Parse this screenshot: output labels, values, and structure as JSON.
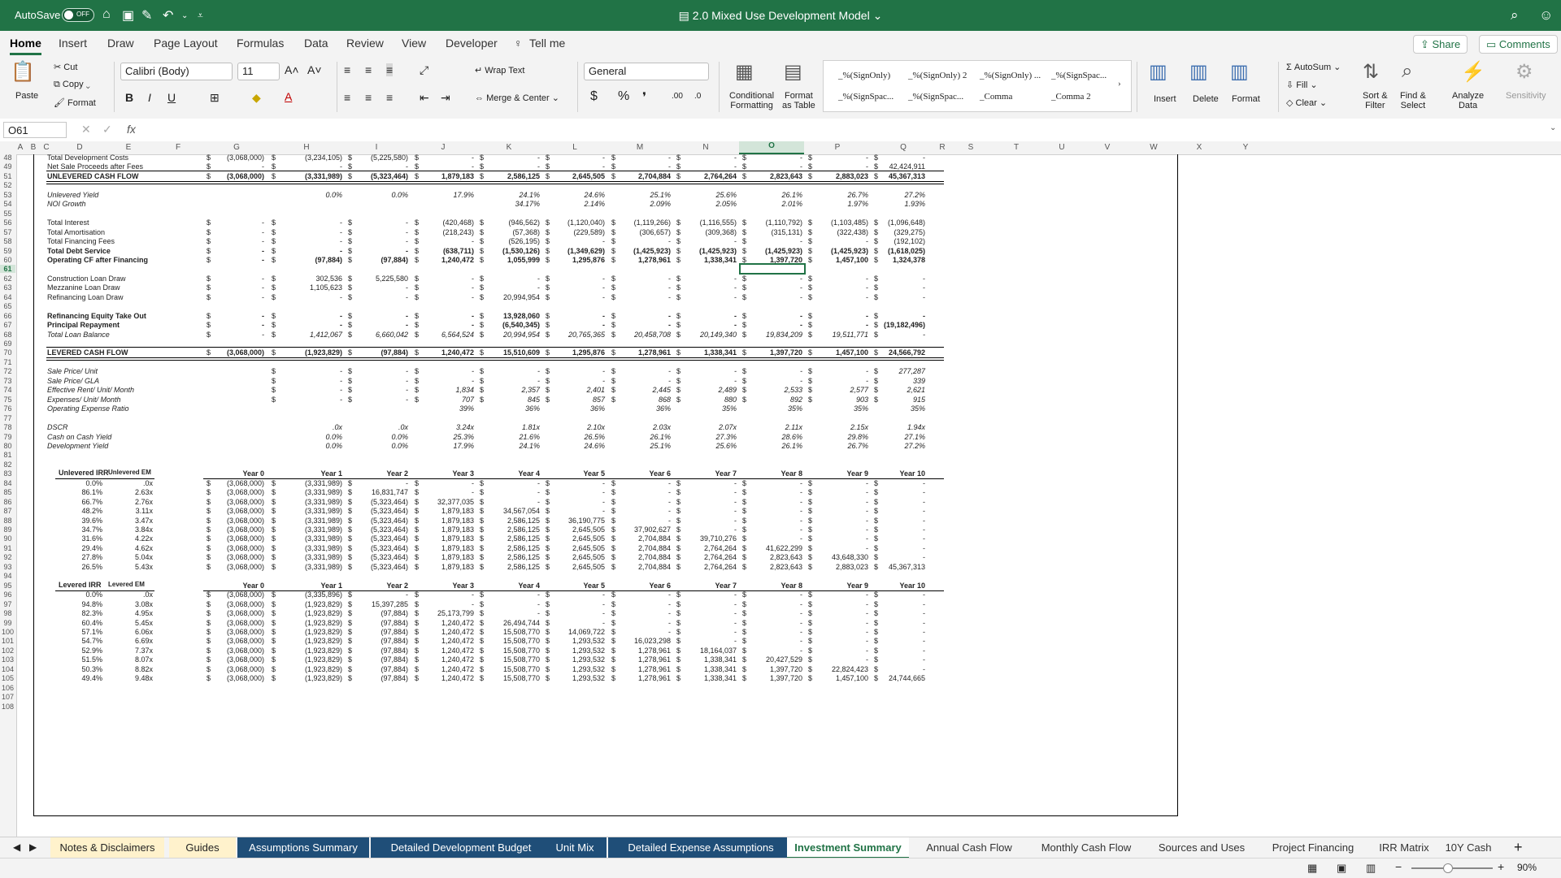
{
  "titlebar": {
    "autosave_label": "AutoSave",
    "autosave_state": "OFF",
    "doc_title": "2.0 Mixed Use Development Model"
  },
  "ribbon_tabs": [
    "Home",
    "Insert",
    "Draw",
    "Page Layout",
    "Formulas",
    "Data",
    "Review",
    "View",
    "Developer",
    "Tell me"
  ],
  "share_label": "Share",
  "comments_label": "Comments",
  "ribbon": {
    "paste": "Paste",
    "cut": "Cut",
    "copy": "Copy",
    "format": "Format",
    "font_name": "Calibri (Body)",
    "font_size": "11",
    "wrap_text": "Wrap Text",
    "merge_center": "Merge & Center",
    "number_format": "General",
    "cond_format": "Conditional",
    "cond_format2": "Formatting",
    "format_table": "Format",
    "format_table2": "as Table",
    "styles": [
      "_%(SignOnly)",
      "_%(SignOnly) 2",
      "_%(SignOnly) ...",
      "_%(SignSpac...",
      "_%(SignSpac...",
      "_%(SignSpac...",
      "_Comma",
      "_Comma 2"
    ],
    "insert": "Insert",
    "delete": "Delete",
    "format_cells": "Format",
    "autosum": "AutoSum",
    "fill": "Fill",
    "clear": "Clear",
    "sort_filter": "Sort &",
    "sort_filter2": "Filter",
    "find_select": "Find &",
    "find_select2": "Select",
    "analyze": "Analyze",
    "analyze2": "Data",
    "sensitivity": "Sensitivity"
  },
  "formula_bar": {
    "name_box": "O61",
    "fx": "fx"
  },
  "columns": [
    "A",
    "B",
    "C",
    "D",
    "E",
    "F",
    "G",
    "H",
    "I",
    "J",
    "K",
    "L",
    "M",
    "N",
    "O",
    "P",
    "Q",
    "R",
    "S",
    "T",
    "U",
    "V",
    "W",
    "X",
    "Y"
  ],
  "row_numbers": [
    "48",
    "49",
    "51",
    "52",
    "53",
    "54",
    "55",
    "56",
    "57",
    "58",
    "59",
    "60",
    "61",
    "62",
    "63",
    "64",
    "65",
    "66",
    "67",
    "68",
    "69",
    "70",
    "71",
    "72",
    "73",
    "74",
    "75",
    "76",
    "77",
    "78",
    "79",
    "80",
    "81",
    "82",
    "83",
    "84",
    "85",
    "86",
    "87",
    "88",
    "89",
    "90",
    "91",
    "92",
    "93",
    "94",
    "95",
    "96",
    "97",
    "98",
    "99",
    "100",
    "101",
    "102",
    "103",
    "104",
    "105",
    "106",
    "107",
    "108"
  ],
  "rows": {
    "r48": {
      "label": "Total Development Costs",
      "vals": [
        "(3,068,000)",
        "(3,234,105)",
        "(5,225,580)",
        "-",
        "-",
        "-",
        "-",
        "-",
        "-",
        "-",
        "-"
      ]
    },
    "r49": {
      "label": "Net Sale Proceeds after Fees",
      "vals": [
        "-",
        "-",
        "-",
        "-",
        "-",
        "-",
        "-",
        "-",
        "-",
        "-",
        "42,424,911"
      ]
    },
    "r51": {
      "label": "UNLEVERED CASH FLOW",
      "vals": [
        "(3,068,000)",
        "(3,331,989)",
        "(5,323,464)",
        "1,879,183",
        "2,586,125",
        "2,645,505",
        "2,704,884",
        "2,764,264",
        "2,823,643",
        "2,883,023",
        "45,367,313"
      ]
    },
    "r53": {
      "label": "Unlevered Yield",
      "vals": [
        "",
        "0.0%",
        "0.0%",
        "17.9%",
        "24.1%",
        "24.6%",
        "25.1%",
        "25.6%",
        "26.1%",
        "26.7%",
        "27.2%"
      ]
    },
    "r54": {
      "label": "NOI Growth",
      "vals": [
        "",
        "",
        "",
        "",
        "34.17%",
        "2.14%",
        "2.09%",
        "2.05%",
        "2.01%",
        "1.97%",
        "1.93%"
      ]
    },
    "r56": {
      "label": "Total Interest",
      "vals": [
        "-",
        "-",
        "-",
        "(420,468)",
        "(946,562)",
        "(1,120,040)",
        "(1,119,266)",
        "(1,116,555)",
        "(1,110,792)",
        "(1,103,485)",
        "(1,096,648)"
      ]
    },
    "r57": {
      "label": "Total Amortisation",
      "vals": [
        "-",
        "-",
        "-",
        "(218,243)",
        "(57,368)",
        "(229,589)",
        "(306,657)",
        "(309,368)",
        "(315,131)",
        "(322,438)",
        "(329,275)"
      ]
    },
    "r58": {
      "label": "Total Financing Fees",
      "vals": [
        "-",
        "-",
        "-",
        "-",
        "(526,195)",
        "-",
        "-",
        "-",
        "-",
        "-",
        "(192,102)"
      ]
    },
    "r59": {
      "label": "Total Debt Service",
      "vals": [
        "-",
        "-",
        "-",
        "(638,711)",
        "(1,530,126)",
        "(1,349,629)",
        "(1,425,923)",
        "(1,425,923)",
        "(1,425,923)",
        "(1,425,923)",
        "(1,618,025)"
      ]
    },
    "r60": {
      "label": "Operating CF after Financing",
      "vals": [
        "-",
        "(97,884)",
        "(97,884)",
        "1,240,472",
        "1,055,999",
        "1,295,876",
        "1,278,961",
        "1,338,341",
        "1,397,720",
        "1,457,100",
        "1,324,378"
      ]
    },
    "r62": {
      "label": "Construction Loan Draw",
      "vals": [
        "-",
        "302,536",
        "5,225,580",
        "-",
        "-",
        "-",
        "-",
        "-",
        "-",
        "-",
        "-"
      ]
    },
    "r63": {
      "label": "Mezzanine Loan Draw",
      "vals": [
        "-",
        "1,105,623",
        "-",
        "-",
        "-",
        "-",
        "-",
        "-",
        "-",
        "-",
        "-"
      ]
    },
    "r64": {
      "label": "Refinancing Loan Draw",
      "vals": [
        "-",
        "-",
        "-",
        "-",
        "20,994,954",
        "-",
        "-",
        "-",
        "-",
        "-",
        "-"
      ]
    },
    "r66": {
      "label": "Refinancing Equity Take Out",
      "vals": [
        "-",
        "-",
        "-",
        "-",
        "13,928,060",
        "-",
        "-",
        "-",
        "-",
        "-",
        "-"
      ]
    },
    "r67": {
      "label": "Principal Repayment",
      "vals": [
        "-",
        "-",
        "-",
        "-",
        "(6,540,345)",
        "-",
        "-",
        "-",
        "-",
        "-",
        "(19,182,496)"
      ]
    },
    "r68": {
      "label": "Total Loan Balance",
      "vals": [
        "-",
        "1,412,067",
        "6,660,042",
        "6,564,524",
        "20,994,954",
        "20,765,365",
        "20,458,708",
        "20,149,340",
        "19,834,209",
        "19,511,771",
        "-"
      ]
    },
    "r70": {
      "label": "LEVERED CASH FLOW",
      "vals": [
        "(3,068,000)",
        "(1,923,829)",
        "(97,884)",
        "1,240,472",
        "15,510,609",
        "1,295,876",
        "1,278,961",
        "1,338,341",
        "1,397,720",
        "1,457,100",
        "24,566,792"
      ]
    },
    "r72": {
      "label": "Sale Price/ Unit",
      "vals": [
        "",
        "-",
        "-",
        "-",
        "-",
        "-",
        "-",
        "-",
        "-",
        "-",
        "277,287"
      ]
    },
    "r73": {
      "label": "Sale Price/ GLA",
      "vals": [
        "",
        "-",
        "-",
        "-",
        "-",
        "-",
        "-",
        "-",
        "-",
        "-",
        "339"
      ]
    },
    "r74": {
      "label": "Effective Rent/ Unit/ Month",
      "vals": [
        "",
        "-",
        "-",
        "1,834",
        "2,357",
        "2,401",
        "2,445",
        "2,489",
        "2,533",
        "2,577",
        "2,621"
      ]
    },
    "r75": {
      "label": "Expenses/ Unit/ Month",
      "vals": [
        "",
        "-",
        "-",
        "707",
        "845",
        "857",
        "868",
        "880",
        "892",
        "903",
        "915"
      ]
    },
    "r76": {
      "label": "Operating Expense Ratio",
      "vals": [
        "",
        "",
        "",
        "39%",
        "36%",
        "36%",
        "36%",
        "35%",
        "35%",
        "35%",
        "35%"
      ]
    },
    "r78": {
      "label": "DSCR",
      "vals": [
        "",
        ".0x",
        ".0x",
        "3.24x",
        "1.81x",
        "2.10x",
        "2.03x",
        "2.07x",
        "2.11x",
        "2.15x",
        "1.94x"
      ]
    },
    "r79": {
      "label": "Cash on Cash Yield",
      "vals": [
        "",
        "0.0%",
        "0.0%",
        "25.3%",
        "21.6%",
        "26.5%",
        "26.1%",
        "27.3%",
        "28.6%",
        "29.8%",
        "27.1%"
      ]
    },
    "r80": {
      "label": "Development Yield",
      "vals": [
        "",
        "0.0%",
        "0.0%",
        "17.9%",
        "24.1%",
        "24.6%",
        "25.1%",
        "25.6%",
        "26.1%",
        "26.7%",
        "27.2%"
      ]
    }
  },
  "unlevered_matrix": {
    "irr_header": "Unlevered IRR",
    "em_header": "Unlevered EM",
    "year_headers": [
      "Year 0",
      "Year 1",
      "Year 2",
      "Year 3",
      "Year 4",
      "Year 5",
      "Year 6",
      "Year 7",
      "Year 8",
      "Year 9",
      "Year 10"
    ],
    "rows": [
      {
        "irr": "0.0%",
        "em": ".0x",
        "vals": [
          "(3,068,000)",
          "(3,331,989)",
          "-",
          "-",
          "-",
          "-",
          "-",
          "-",
          "-",
          "-",
          "-"
        ]
      },
      {
        "irr": "86.1%",
        "em": "2.63x",
        "vals": [
          "(3,068,000)",
          "(3,331,989)",
          "16,831,747",
          "-",
          "-",
          "-",
          "-",
          "-",
          "-",
          "-",
          "-"
        ]
      },
      {
        "irr": "66.7%",
        "em": "2.76x",
        "vals": [
          "(3,068,000)",
          "(3,331,989)",
          "(5,323,464)",
          "32,377,035",
          "-",
          "-",
          "-",
          "-",
          "-",
          "-",
          "-"
        ]
      },
      {
        "irr": "48.2%",
        "em": "3.11x",
        "vals": [
          "(3,068,000)",
          "(3,331,989)",
          "(5,323,464)",
          "1,879,183",
          "34,567,054",
          "-",
          "-",
          "-",
          "-",
          "-",
          "-"
        ]
      },
      {
        "irr": "39.6%",
        "em": "3.47x",
        "vals": [
          "(3,068,000)",
          "(3,331,989)",
          "(5,323,464)",
          "1,879,183",
          "2,586,125",
          "36,190,775",
          "-",
          "-",
          "-",
          "-",
          "-"
        ]
      },
      {
        "irr": "34.7%",
        "em": "3.84x",
        "vals": [
          "(3,068,000)",
          "(3,331,989)",
          "(5,323,464)",
          "1,879,183",
          "2,586,125",
          "2,645,505",
          "37,902,627",
          "-",
          "-",
          "-",
          "-"
        ]
      },
      {
        "irr": "31.6%",
        "em": "4.22x",
        "vals": [
          "(3,068,000)",
          "(3,331,989)",
          "(5,323,464)",
          "1,879,183",
          "2,586,125",
          "2,645,505",
          "2,704,884",
          "39,710,276",
          "-",
          "-",
          "-"
        ]
      },
      {
        "irr": "29.4%",
        "em": "4.62x",
        "vals": [
          "(3,068,000)",
          "(3,331,989)",
          "(5,323,464)",
          "1,879,183",
          "2,586,125",
          "2,645,505",
          "2,704,884",
          "2,764,264",
          "41,622,299",
          "-",
          "-"
        ]
      },
      {
        "irr": "27.8%",
        "em": "5.04x",
        "vals": [
          "(3,068,000)",
          "(3,331,989)",
          "(5,323,464)",
          "1,879,183",
          "2,586,125",
          "2,645,505",
          "2,704,884",
          "2,764,264",
          "2,823,643",
          "43,648,330",
          "-"
        ]
      },
      {
        "irr": "26.5%",
        "em": "5.43x",
        "vals": [
          "(3,068,000)",
          "(3,331,989)",
          "(5,323,464)",
          "1,879,183",
          "2,586,125",
          "2,645,505",
          "2,704,884",
          "2,764,264",
          "2,823,643",
          "2,883,023",
          "45,367,313"
        ]
      }
    ]
  },
  "levered_matrix": {
    "irr_header": "Levered IRR",
    "em_header": "Levered EM",
    "year_headers": [
      "Year 0",
      "Year 1",
      "Year 2",
      "Year 3",
      "Year 4",
      "Year 5",
      "Year 6",
      "Year 7",
      "Year 8",
      "Year 9",
      "Year 10"
    ],
    "rows": [
      {
        "irr": "0.0%",
        "em": ".0x",
        "vals": [
          "(3,068,000)",
          "(3,335,896)",
          "-",
          "-",
          "-",
          "-",
          "-",
          "-",
          "-",
          "-",
          "-"
        ]
      },
      {
        "irr": "94.8%",
        "em": "3.08x",
        "vals": [
          "(3,068,000)",
          "(1,923,829)",
          "15,397,285",
          "-",
          "-",
          "-",
          "-",
          "-",
          "-",
          "-",
          "-"
        ]
      },
      {
        "irr": "82.3%",
        "em": "4.95x",
        "vals": [
          "(3,068,000)",
          "(1,923,829)",
          "(97,884)",
          "25,173,799",
          "-",
          "-",
          "-",
          "-",
          "-",
          "-",
          "-"
        ]
      },
      {
        "irr": "60.4%",
        "em": "5.45x",
        "vals": [
          "(3,068,000)",
          "(1,923,829)",
          "(97,884)",
          "1,240,472",
          "26,494,744",
          "-",
          "-",
          "-",
          "-",
          "-",
          "-"
        ]
      },
      {
        "irr": "57.1%",
        "em": "6.06x",
        "vals": [
          "(3,068,000)",
          "(1,923,829)",
          "(97,884)",
          "1,240,472",
          "15,508,770",
          "14,069,722",
          "-",
          "-",
          "-",
          "-",
          "-"
        ]
      },
      {
        "irr": "54.7%",
        "em": "6.69x",
        "vals": [
          "(3,068,000)",
          "(1,923,829)",
          "(97,884)",
          "1,240,472",
          "15,508,770",
          "1,293,532",
          "16,023,298",
          "-",
          "-",
          "-",
          "-"
        ]
      },
      {
        "irr": "52.9%",
        "em": "7.37x",
        "vals": [
          "(3,068,000)",
          "(1,923,829)",
          "(97,884)",
          "1,240,472",
          "15,508,770",
          "1,293,532",
          "1,278,961",
          "18,164,037",
          "-",
          "-",
          "-"
        ]
      },
      {
        "irr": "51.5%",
        "em": "8.07x",
        "vals": [
          "(3,068,000)",
          "(1,923,829)",
          "(97,884)",
          "1,240,472",
          "15,508,770",
          "1,293,532",
          "1,278,961",
          "1,338,341",
          "20,427,529",
          "-",
          "-"
        ]
      },
      {
        "irr": "50.3%",
        "em": "8.82x",
        "vals": [
          "(3,068,000)",
          "(1,923,829)",
          "(97,884)",
          "1,240,472",
          "15,508,770",
          "1,293,532",
          "1,278,961",
          "1,338,341",
          "1,397,720",
          "22,824,423",
          "-"
        ]
      },
      {
        "irr": "49.4%",
        "em": "9.48x",
        "vals": [
          "(3,068,000)",
          "(1,923,829)",
          "(97,884)",
          "1,240,472",
          "15,508,770",
          "1,293,532",
          "1,278,961",
          "1,338,341",
          "1,397,720",
          "1,457,100",
          "24,744,665"
        ]
      }
    ]
  },
  "sheet_tabs": [
    {
      "label": "Notes & Disclaimers",
      "style": "yellow"
    },
    {
      "label": "Guides",
      "style": "yellow"
    },
    {
      "label": "Assumptions Summary",
      "style": "blue"
    },
    {
      "label": "Detailed Development Budget",
      "style": "blue"
    },
    {
      "label": "Unit Mix",
      "style": "blue"
    },
    {
      "label": "Detailed Expense Assumptions",
      "style": "blue"
    },
    {
      "label": "Investment Summary",
      "style": "active"
    },
    {
      "label": "Annual Cash Flow",
      "style": "plain"
    },
    {
      "label": "Monthly Cash Flow",
      "style": "plain"
    },
    {
      "label": "Sources and Uses",
      "style": "plain"
    },
    {
      "label": "Project Financing",
      "style": "plain"
    },
    {
      "label": "IRR Matrix",
      "style": "plain"
    },
    {
      "label": "10Y Cash",
      "style": "plain"
    }
  ],
  "zoom": "90%",
  "colors": {
    "excel_green": "#217346",
    "tab_blue": "#1f4e78",
    "tab_yellow": "#fff2cc"
  }
}
